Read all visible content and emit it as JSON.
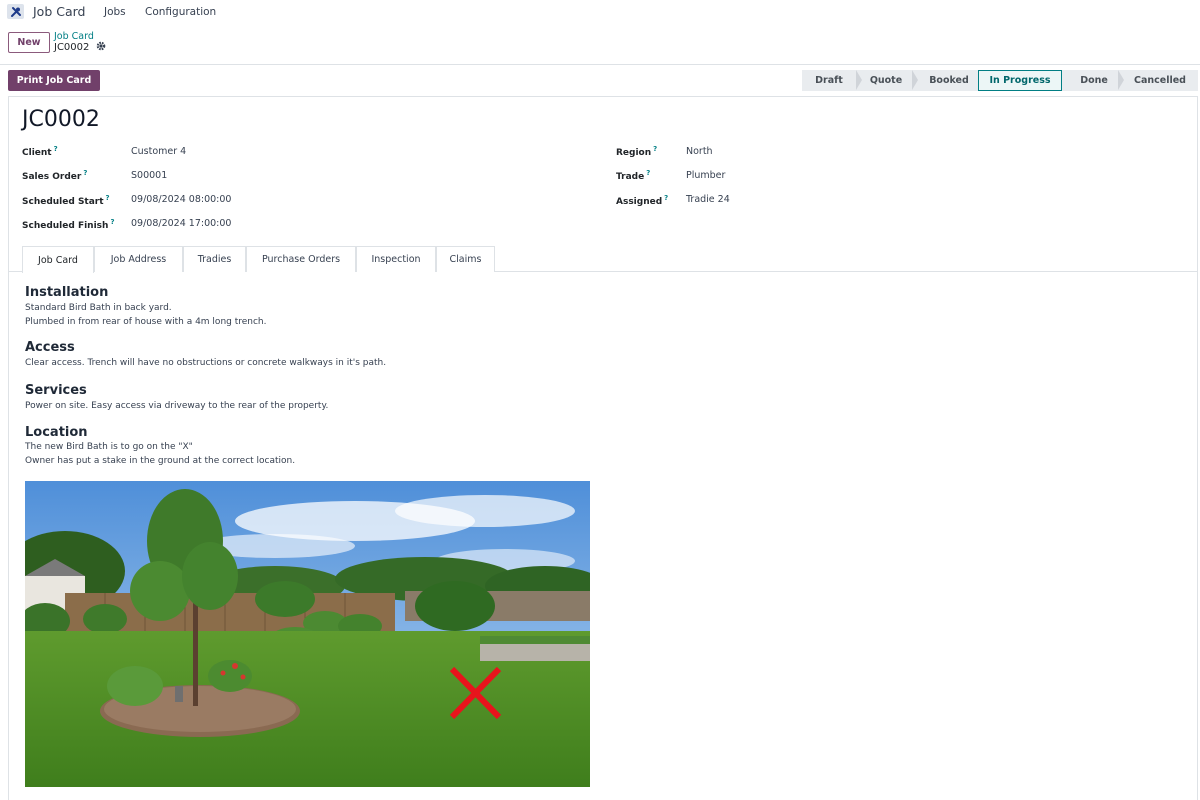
{
  "navbar": {
    "app_name": "Job Card",
    "menu": [
      "Jobs",
      "Configuration"
    ]
  },
  "control_panel": {
    "new_label": "New",
    "breadcrumb_parent": "Job Card",
    "breadcrumb_current": "JC0002",
    "print_label": "Print Job Card"
  },
  "statusbar": {
    "stages": [
      "Draft",
      "Quote",
      "Booked",
      "In Progress",
      "Done",
      "Cancelled"
    ],
    "active": "In Progress"
  },
  "record": {
    "title": "JC0002",
    "help_mark": "?",
    "left_fields": [
      {
        "label": "Client",
        "value": "Customer 4"
      },
      {
        "label": "Sales Order",
        "value": "S00001"
      },
      {
        "label": "Scheduled Start",
        "value": "09/08/2024 08:00:00"
      },
      {
        "label": "Scheduled Finish",
        "value": "09/08/2024 17:00:00"
      }
    ],
    "right_fields": [
      {
        "label": "Region",
        "value": "North"
      },
      {
        "label": "Trade",
        "value": "Plumber"
      },
      {
        "label": "Assigned",
        "value": "Tradie 24"
      }
    ]
  },
  "tabs": [
    "Job Card",
    "Job Address",
    "Tradies",
    "Purchase Orders",
    "Inspection",
    "Claims"
  ],
  "content": {
    "installation": {
      "heading": "Installation",
      "lines": [
        "Standard Bird Bath in back yard.",
        "Plumbed in from rear of house with a 4m long trench."
      ]
    },
    "access": {
      "heading": "Access",
      "lines": [
        "Clear access. Trench will have no obstructions or concrete walkways in it's path."
      ]
    },
    "services": {
      "heading": "Services",
      "lines": [
        "Power on site. Easy access via driveway to the rear of the property."
      ]
    },
    "location": {
      "heading": "Location",
      "lines": [
        "The new Bird Bath is to go on the \"X\"",
        "Owner has put a stake in the ground at the correct location."
      ]
    }
  },
  "colors": {
    "primary": "#71406a",
    "accent": "#017e84",
    "mark": "#e8141c"
  },
  "icons": {
    "app": "wrench-screwdriver-icon",
    "settings": "gear-icon"
  }
}
